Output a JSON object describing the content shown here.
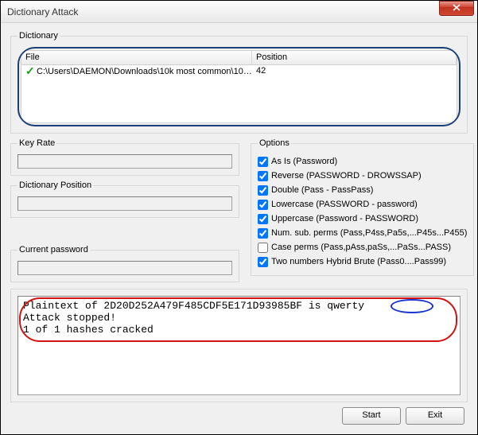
{
  "window": {
    "title": "Dictionary Attack"
  },
  "dictionary": {
    "legend": "Dictionary",
    "columns": {
      "file": "File",
      "position": "Position"
    },
    "rows": [
      {
        "file": "C:\\Users\\DAEMON\\Downloads\\10k most common\\10k ...",
        "position": "42"
      }
    ]
  },
  "keyrate": {
    "legend": "Key Rate",
    "value": ""
  },
  "dictpos": {
    "legend": "Dictionary Position",
    "value": ""
  },
  "curpwd": {
    "legend": "Current password",
    "value": ""
  },
  "options": {
    "legend": "Options",
    "items": [
      {
        "label": "As Is (Password)",
        "checked": true
      },
      {
        "label": "Reverse (PASSWORD - DROWSSAP)",
        "checked": true
      },
      {
        "label": "Double (Pass - PassPass)",
        "checked": true
      },
      {
        "label": "Lowercase (PASSWORD - password)",
        "checked": true
      },
      {
        "label": "Uppercase (Password - PASSWORD)",
        "checked": true
      },
      {
        "label": "Num. sub. perms (Pass,P4ss,Pa5s,...P45s...P455)",
        "checked": true
      },
      {
        "label": "Case perms (Pass,pAss,paSs,...PaSs...PASS)",
        "checked": false
      },
      {
        "label": "Two numbers Hybrid Brute (Pass0....Pass99)",
        "checked": true
      }
    ]
  },
  "output": {
    "lines": [
      "Plaintext of 2D20D252A479F485CDF5E171D93985BF is qwerty",
      "Attack stopped!",
      "1 of 1 hashes cracked"
    ]
  },
  "buttons": {
    "start": "Start",
    "exit": "Exit"
  }
}
